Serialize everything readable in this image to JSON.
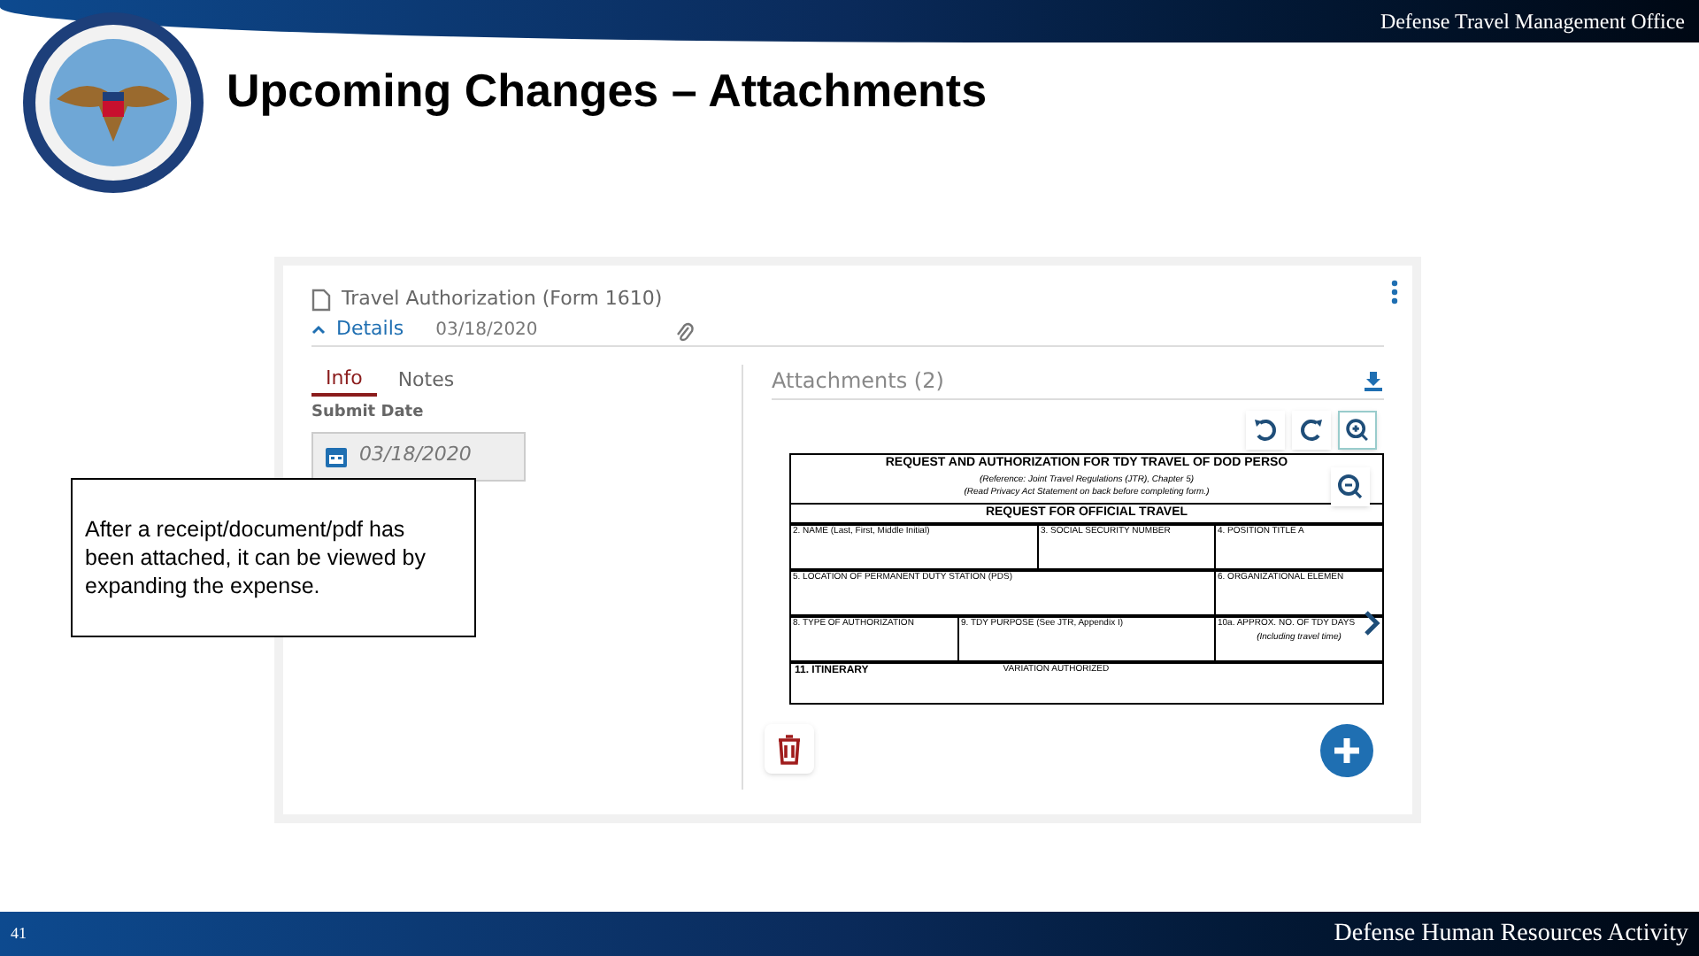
{
  "header": {
    "org": "Defense Travel Management Office",
    "title": "Upcoming Changes – Attachments"
  },
  "app": {
    "document_title": "Travel Authorization (Form 1610)",
    "section": {
      "label": "Details",
      "expanded": true,
      "date": "03/18/2020"
    },
    "tabs": [
      {
        "label": "Info",
        "selected": true
      },
      {
        "label": "Notes",
        "selected": false
      }
    ],
    "submit_date": {
      "label": "Submit Date",
      "value": "03/18/2020"
    },
    "attachments": {
      "title": "Attachments (2)",
      "form": {
        "title": "REQUEST AND AUTHORIZATION FOR TDY TRAVEL OF DOD PERSO",
        "subtitle_1": "(Reference: Joint Travel Regulations (JTR), Chapter 5)",
        "subtitle_2": "(Read Privacy Act Statement on back before completing form.)",
        "section": "REQUEST FOR OFFICIAL TRAVEL",
        "rows": [
          [
            {
              "label": "2. NAME (Last, First, Middle Initial)"
            },
            "",
            {
              "label": "3. SOCIAL SECURITY NUMBER"
            },
            {
              "label": "4. POSITION TITLE A"
            }
          ],
          [
            {
              "label": "5. LOCATION OF PERMANENT DUTY STATION (PDS)"
            },
            "",
            "",
            {
              "label": "6. ORGANIZATIONAL ELEMEN"
            }
          ],
          [
            {
              "label": "8. TYPE OF AUTHORIZATION"
            },
            {
              "label": "9. TDY PURPOSE (See JTR, Appendix I)"
            },
            "",
            {
              "label": "10a. APPROX. NO. OF TDY DAYS",
              "note": "(Including travel time)"
            }
          ]
        ],
        "itinerary": "11. ITINERARY",
        "variation": "VARIATION AUTHORIZED"
      }
    }
  },
  "callout": "After a receipt/document/pdf has been attached, it can be viewed by expanding the expense.",
  "footer": {
    "page": "41",
    "org": "Defense Human Resources Activity"
  }
}
